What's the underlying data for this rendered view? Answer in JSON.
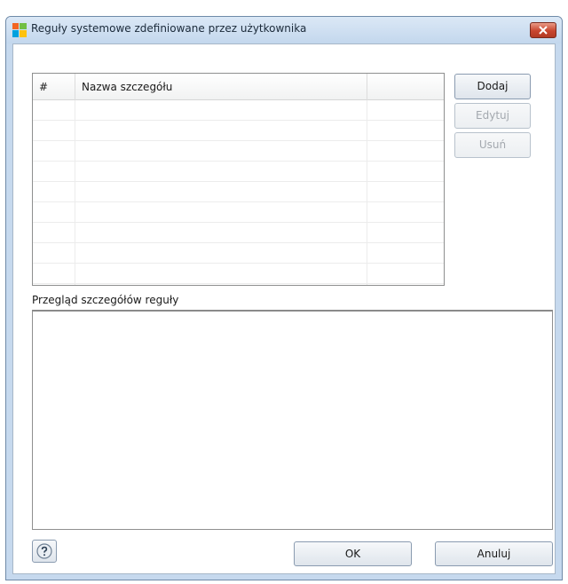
{
  "window": {
    "title": "Reguły systemowe zdefiniowane przez użytkownika",
    "app_icon": "avg-logo-icon",
    "close_icon": "close-icon"
  },
  "table": {
    "columns": [
      "#",
      "Nazwa szczegółu",
      ""
    ],
    "rows": []
  },
  "side_buttons": {
    "add": "Dodaj",
    "edit": "Edytuj",
    "delete": "Usuń"
  },
  "details": {
    "label": "Przegląd szczegółów reguły"
  },
  "footer": {
    "help_icon": "help-icon",
    "ok": "OK",
    "cancel": "Anuluj"
  },
  "colors": {
    "titlebar": "#c9dcf0",
    "close_button": "#c8452e",
    "disabled_text": "#a3a8ae"
  }
}
